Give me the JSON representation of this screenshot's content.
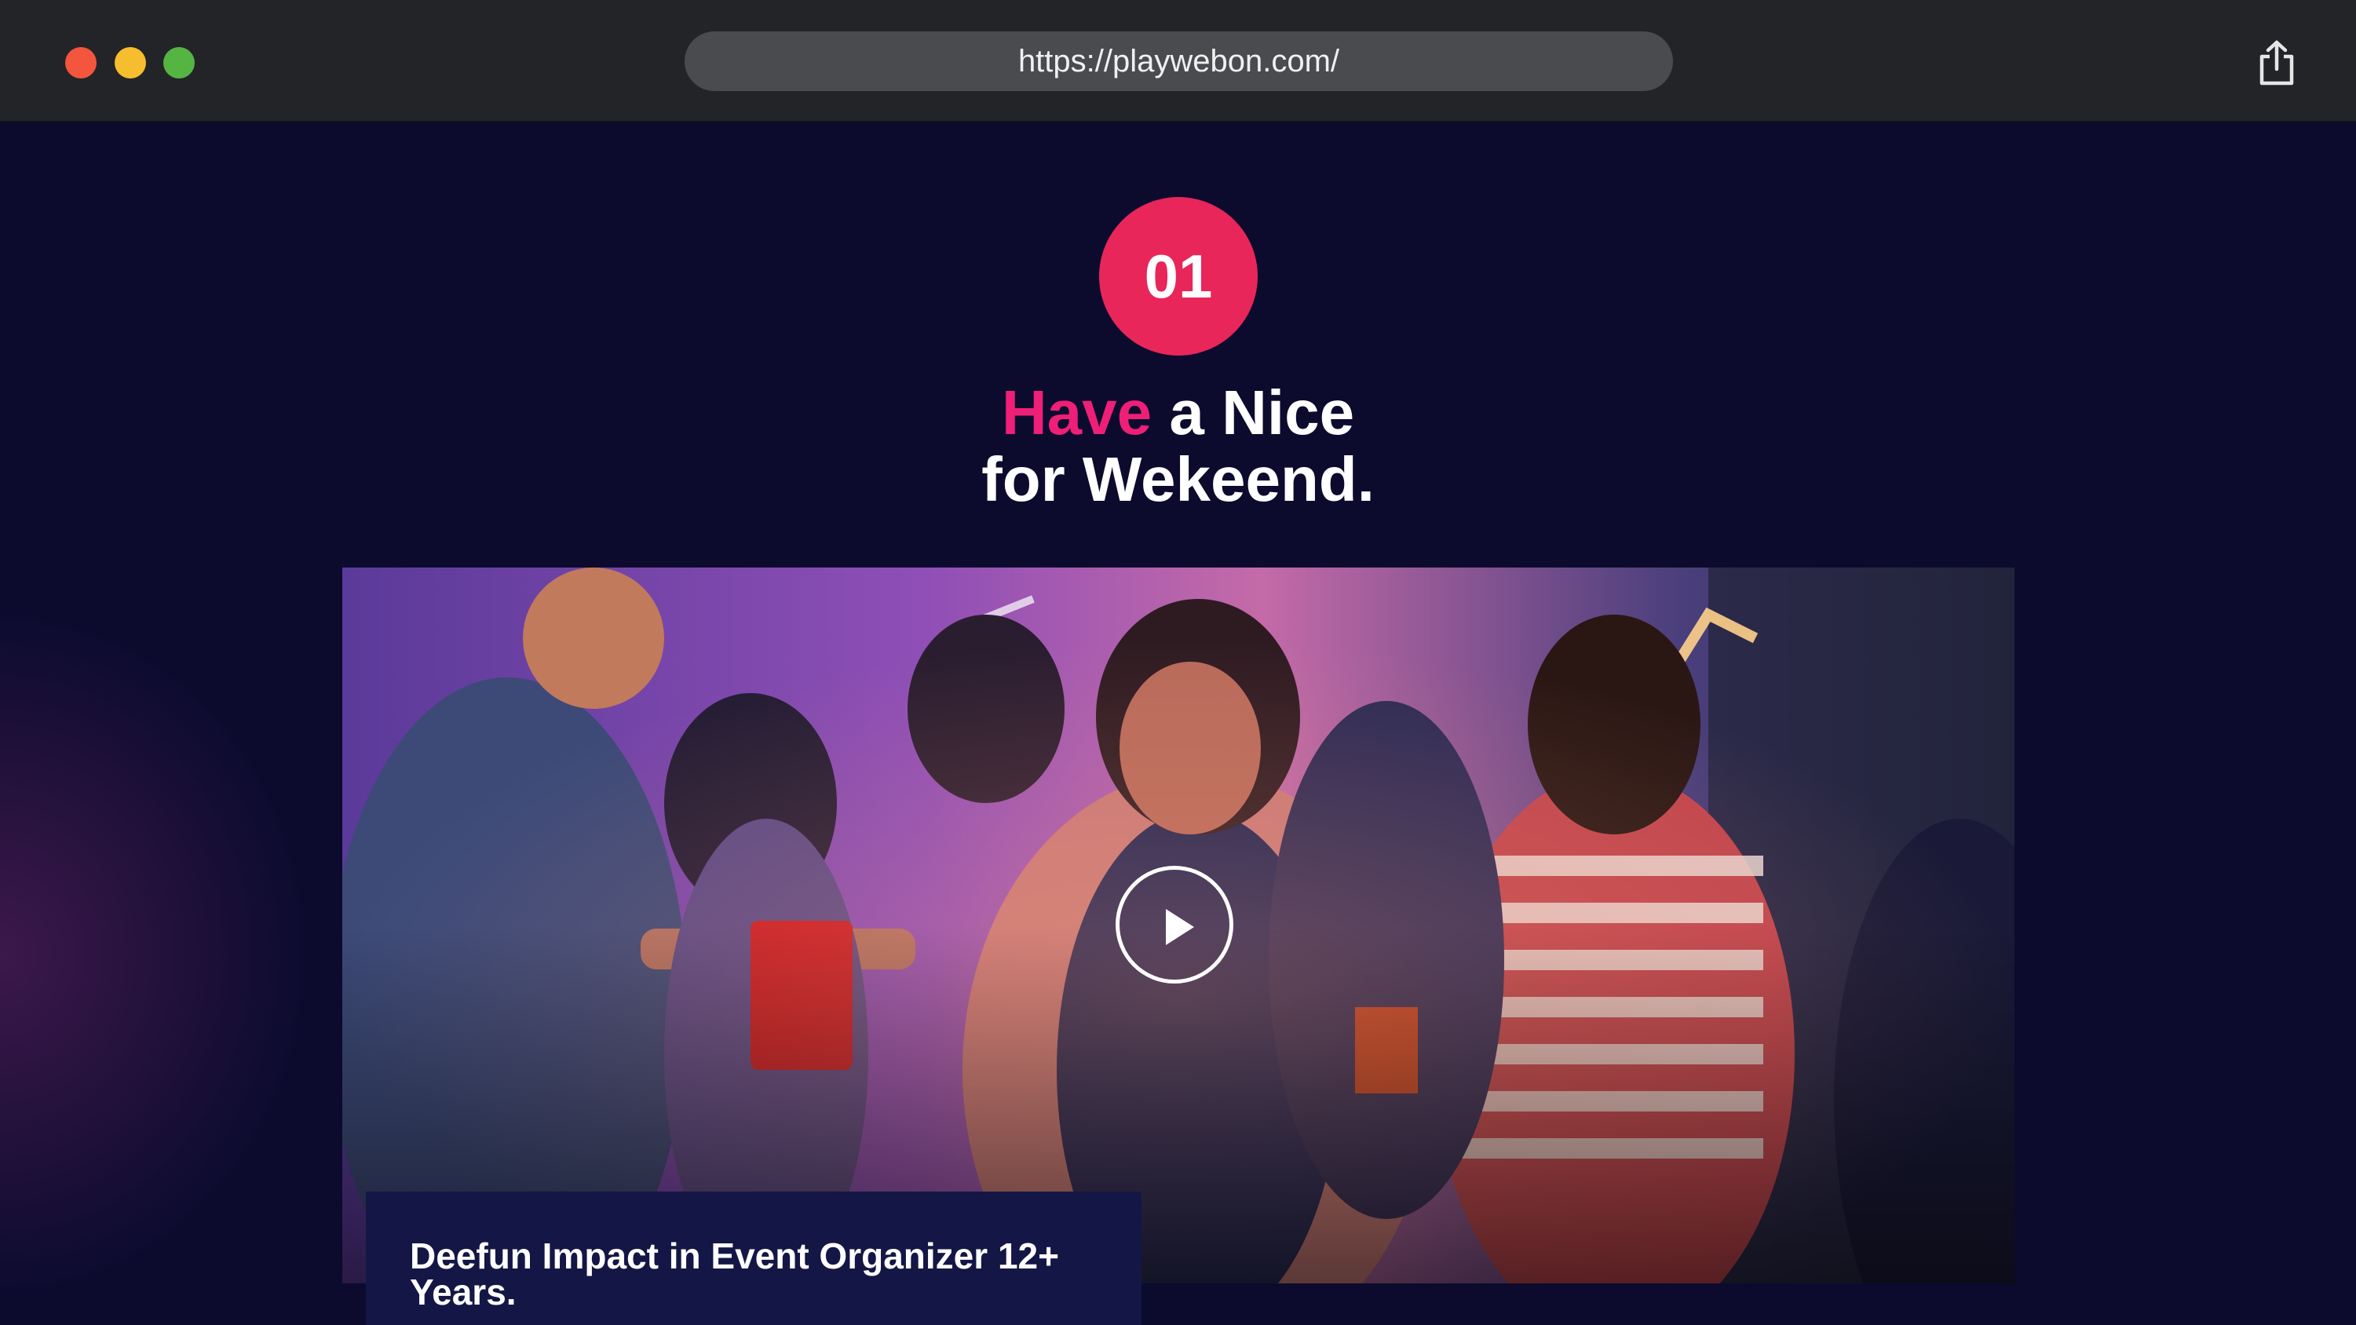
{
  "browser": {
    "url": "https://playwebon.com/",
    "icons": {
      "share": "share-icon"
    }
  },
  "section": {
    "number": "01",
    "title_accent": "Have",
    "title_line1_rest": " a Nice",
    "title_line2": "for Wekeend."
  },
  "hero": {
    "image": "party-photo",
    "play_icon": "play-icon"
  },
  "caption": {
    "text": "Deefun Impact in Event Organizer 12+ Years."
  },
  "colors": {
    "badge": "#e8265a",
    "accent": "#ee1f77",
    "background": "#0c0b2e",
    "caption_bg": "#141745"
  }
}
